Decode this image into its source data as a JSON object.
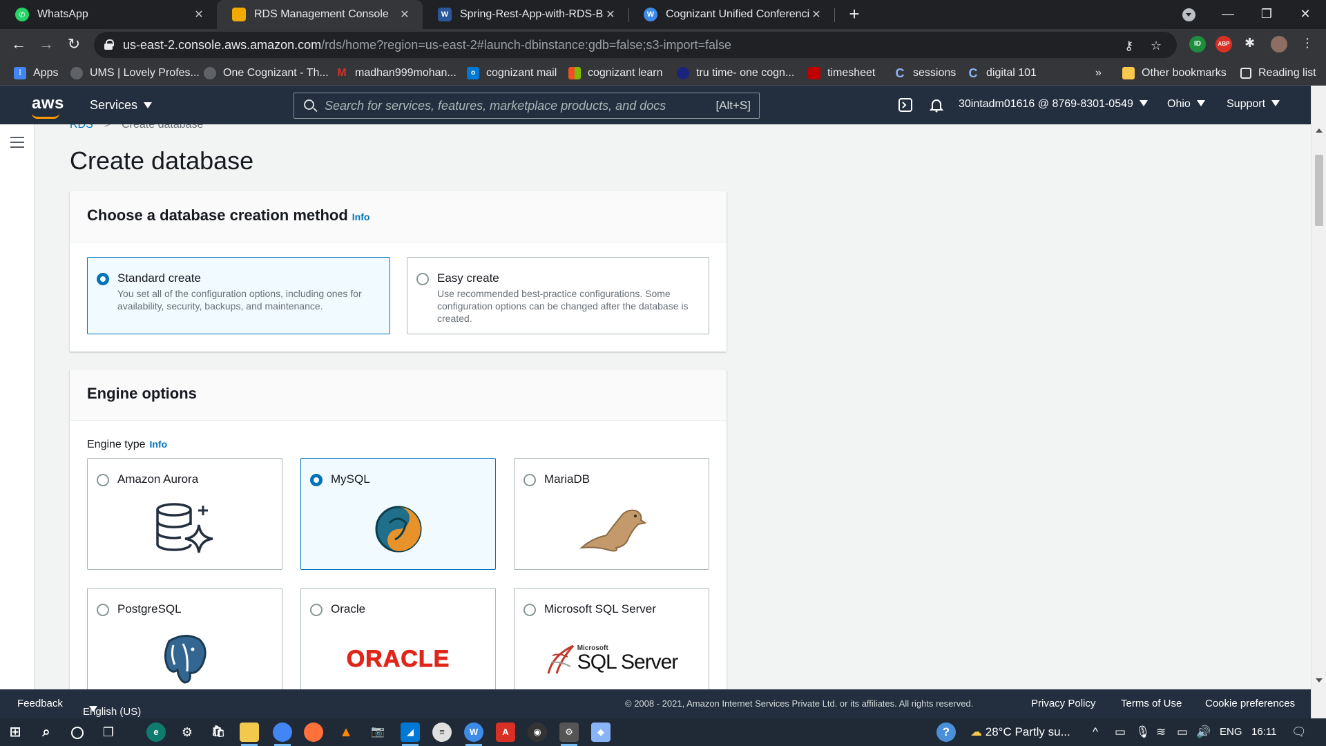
{
  "browser": {
    "tabs": [
      {
        "title": "WhatsApp",
        "icon": "whatsapp-icon",
        "color": "#25d366",
        "active": false
      },
      {
        "title": "RDS Management Console",
        "icon": "aws-box-icon",
        "color": "#f2a900",
        "active": true
      },
      {
        "title": "Spring-Rest-App-with-RDS-Backend",
        "icon": "word-icon",
        "color": "#2b579a",
        "active": false
      },
      {
        "title": "Cognizant Unified Conferencing",
        "icon": "webex-icon",
        "color": "#3d8be8",
        "active": false
      }
    ],
    "url_host": "us-east-2.console.aws.amazon.com",
    "url_path": "/rds/home?region=us-east-2#launch-dbinstance:gdb=false;s3-import=false",
    "bookmarks": [
      {
        "label": "Apps",
        "color": "#4285f4"
      },
      {
        "label": "UMS | Lovely Profes...",
        "color": "#5f6368"
      },
      {
        "label": "One Cognizant - Th...",
        "color": "#5f6368"
      },
      {
        "label": "madhan999mohan...",
        "color": "#d93025"
      },
      {
        "label": "cognizant mail",
        "color": "#0078d4"
      },
      {
        "label": "cognizant learn",
        "color": "#f25022"
      },
      {
        "label": "tru time- one cogn...",
        "color": "#1a237e"
      },
      {
        "label": "timesheet",
        "color": "#c00000"
      },
      {
        "label": "sessions",
        "color": "#1a73e8"
      },
      {
        "label": "digital 101",
        "color": "#1a73e8"
      }
    ],
    "bookmarks_overflow": "»",
    "other_bookmarks": "Other bookmarks",
    "reading_list": "Reading list"
  },
  "aws_header": {
    "logo": "aws",
    "services_label": "Services",
    "search_placeholder": "Search for services, features, marketplace products, and docs",
    "search_shortcut": "[Alt+S]",
    "account": "30intadm01616 @ 8769-8301-0549",
    "region": "Ohio",
    "support": "Support"
  },
  "breadcrumb": {
    "root": "RDS",
    "current": "Create database"
  },
  "page_title": "Create database",
  "creation_method": {
    "heading": "Choose a database creation method",
    "info": "Info",
    "options": [
      {
        "label": "Standard create",
        "desc": "You set all of the configuration options, including ones for availability, security, backups, and maintenance.",
        "selected": true
      },
      {
        "label": "Easy create",
        "desc": "Use recommended best-practice configurations. Some configuration options can be changed after the database is created.",
        "selected": false
      }
    ]
  },
  "engine_options": {
    "heading": "Engine options",
    "engine_type_label": "Engine type",
    "info": "Info",
    "engines": [
      {
        "label": "Amazon Aurora",
        "icon": "aurora-icon",
        "selected": false
      },
      {
        "label": "MySQL",
        "icon": "mysql-icon",
        "selected": true
      },
      {
        "label": "MariaDB",
        "icon": "mariadb-seal-icon",
        "selected": false
      },
      {
        "label": "PostgreSQL",
        "icon": "postgresql-elephant-icon",
        "selected": false
      },
      {
        "label": "Oracle",
        "icon": "oracle-logo",
        "logo_text": "ORACLE",
        "selected": false
      },
      {
        "label": "Microsoft SQL Server",
        "icon": "sql-server-logo",
        "logo_small": "Microsoft",
        "logo_text": "SQL Server",
        "selected": false
      }
    ]
  },
  "footer": {
    "feedback": "Feedback",
    "language": "English (US)",
    "copyright": "© 2008 - 2021, Amazon Internet Services Private Ltd. or its affiliates. All rights reserved.",
    "privacy": "Privacy Policy",
    "terms": "Terms of Use",
    "cookies": "Cookie preferences"
  },
  "taskbar": {
    "weather": "28°C  Partly su...",
    "lang": "ENG",
    "time": "16:11"
  },
  "colors": {
    "aws_dark": "#232f3e",
    "aws_orange": "#ff9900",
    "link_blue": "#0073bb",
    "oracle_red": "#e0261b"
  }
}
